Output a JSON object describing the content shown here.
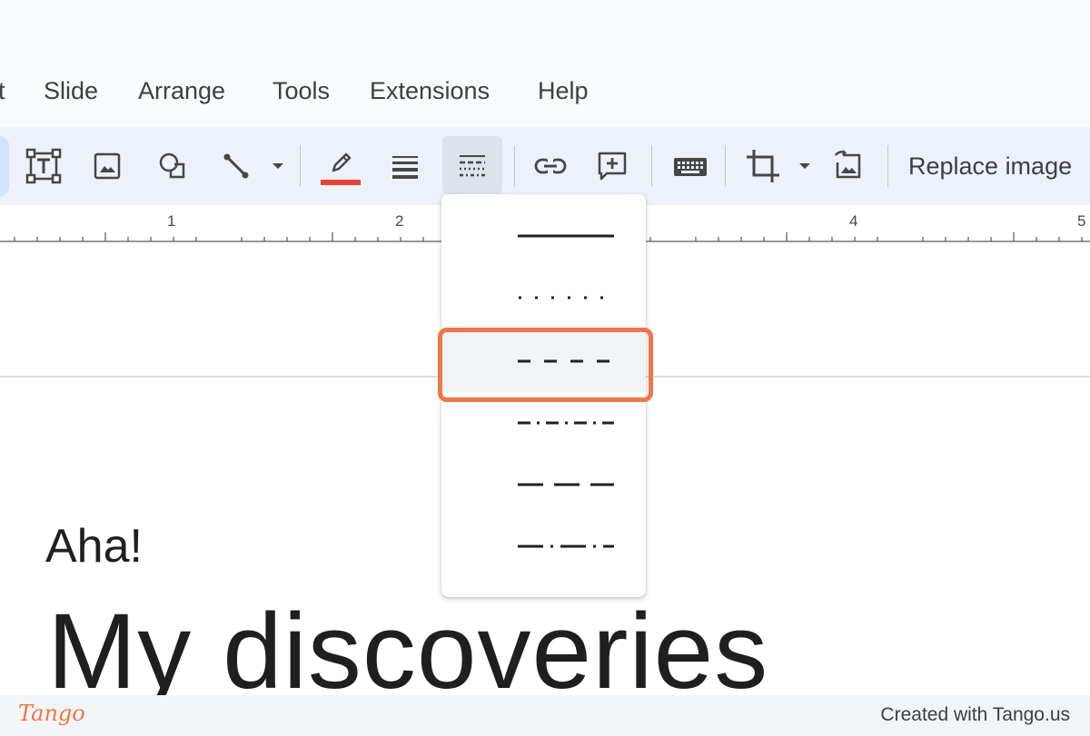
{
  "menu": {
    "items": [
      "t",
      "Slide",
      "Arrange",
      "Tools",
      "Extensions",
      "Help"
    ]
  },
  "toolbar": {
    "buttons": [
      {
        "icon": "text-box-icon"
      },
      {
        "icon": "image-icon"
      },
      {
        "icon": "shapes-icon"
      },
      {
        "icon": "line-icon"
      },
      {
        "icon": "dropdown-arrow-icon"
      },
      {
        "icon": "border-color-icon",
        "color": "#ea4335"
      },
      {
        "icon": "border-weight-icon"
      },
      {
        "icon": "border-dash-icon",
        "active": true
      },
      {
        "icon": "link-icon"
      },
      {
        "icon": "add-comment-icon"
      },
      {
        "icon": "keyboard-icon"
      },
      {
        "icon": "crop-icon"
      },
      {
        "icon": "dropdown-arrow-icon"
      },
      {
        "icon": "reset-image-icon"
      }
    ],
    "replace_image_label": "Replace image"
  },
  "ruler": {
    "numbers": [
      "1",
      "2",
      "4",
      "5"
    ]
  },
  "dash_menu": {
    "options": [
      "solid",
      "dotted",
      "dash",
      "dash-dot",
      "long-dash",
      "long-dash-dot"
    ],
    "highlighted": "dash"
  },
  "slide": {
    "subtitle": "Aha!",
    "title": "My discoveries"
  },
  "footer": {
    "logo": "Tango",
    "credit": "Created with Tango.us"
  },
  "colors": {
    "accent": "#f17547",
    "border_color_bar": "#ea4335",
    "toolbar_bg": "#edf2fa"
  }
}
